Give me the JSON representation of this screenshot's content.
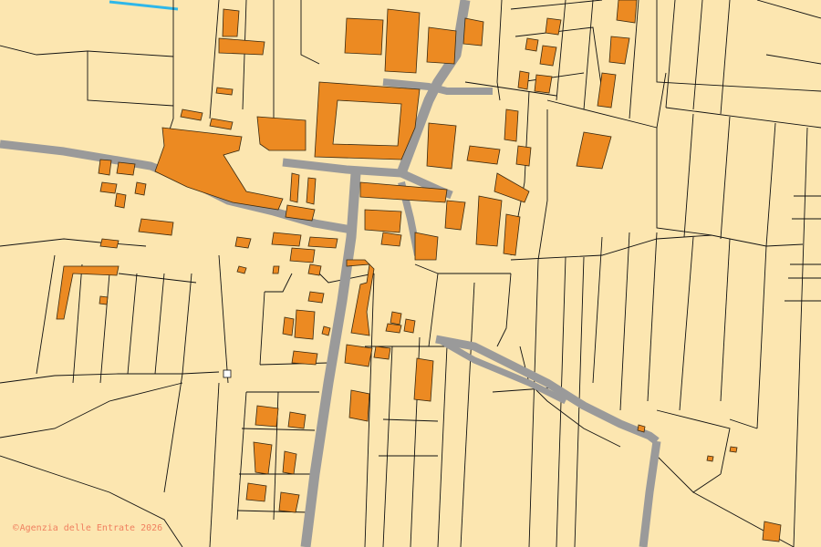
{
  "map": {
    "attribution_symbol": "©",
    "attribution_text": "Agenzia delle Entrate 2026",
    "colors": {
      "background": "#fce6b0",
      "building": "#ec8a22",
      "road": "#9a9a9a",
      "parcel_line": "#111111",
      "water": "#2fb7e9",
      "attribution": "#f08060"
    }
  }
}
